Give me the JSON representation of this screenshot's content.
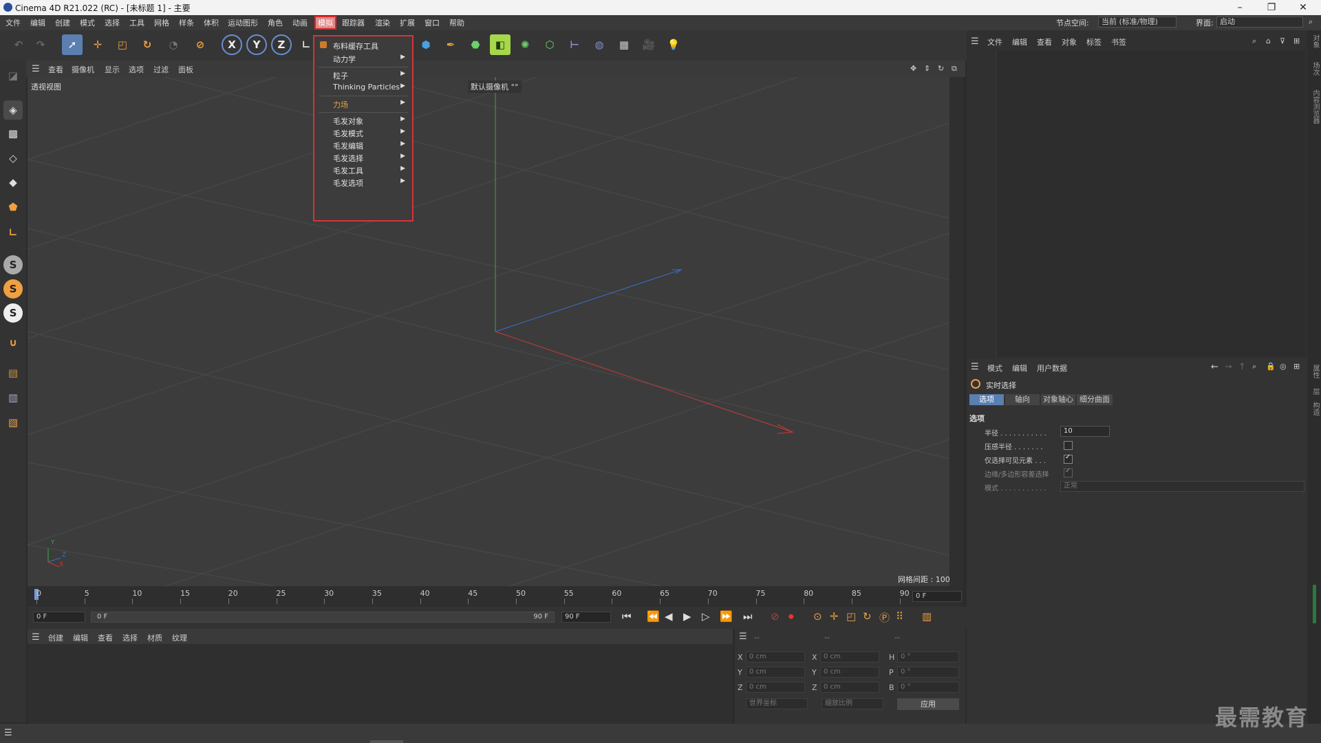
{
  "window": {
    "title": "Cinema 4D R21.022 (RC) - [未标题 1] - 主要",
    "min": "–",
    "restore": "❐",
    "close": "✕"
  },
  "menubar": {
    "items": [
      "文件",
      "编辑",
      "创建",
      "模式",
      "选择",
      "工具",
      "网格",
      "样条",
      "体积",
      "运动图形",
      "角色",
      "动画",
      "模拟",
      "跟踪器",
      "渲染",
      "扩展",
      "窗口",
      "帮助"
    ],
    "active": "模拟",
    "node_space_label": "节点空间:",
    "node_space_value": "当前 (标准/物理)",
    "layout_label": "界面:",
    "layout_value": "启动"
  },
  "dropdown": {
    "items": [
      {
        "label": "布料缓存工具",
        "submenu": false
      },
      {
        "label": "动力学",
        "submenu": true
      },
      {
        "label": "粒子",
        "submenu": true
      },
      {
        "label": "Thinking Particles",
        "submenu": true
      },
      {
        "label": "力场",
        "submenu": true
      },
      {
        "label": "毛发对象",
        "submenu": true
      },
      {
        "label": "毛发模式",
        "submenu": true
      },
      {
        "label": "毛发编辑",
        "submenu": true
      },
      {
        "label": "毛发选择",
        "submenu": true
      },
      {
        "label": "毛发工具",
        "submenu": true
      },
      {
        "label": "毛发选项",
        "submenu": true
      }
    ]
  },
  "toolbar": {
    "x": "X",
    "y": "Y",
    "z": "Z"
  },
  "viewport": {
    "menu": [
      "查看",
      "摄像机",
      "显示",
      "选项",
      "过滤",
      "面板"
    ],
    "name": "透视视图",
    "camera": "默认摄像机 °°",
    "grid_spacing": "网格间距 : 100 cm",
    "axis_y": "Y",
    "axis_z": "Z",
    "axis_x": "X"
  },
  "timeline": {
    "ticks": [
      "0",
      "5",
      "10",
      "15",
      "20",
      "25",
      "30",
      "35",
      "40",
      "45",
      "50",
      "55",
      "60",
      "65",
      "70",
      "75",
      "80",
      "85",
      "90"
    ],
    "current_frame": "0 F",
    "start_field": "0 F",
    "range_start": "0 F",
    "range_end": "90 F",
    "end_field": "90 F"
  },
  "materials": {
    "menu": [
      "创建",
      "编辑",
      "查看",
      "选择",
      "材质",
      "纹理"
    ]
  },
  "coords": {
    "header": [
      "--",
      "--",
      "--"
    ],
    "rows": [
      {
        "l1": "X",
        "v1": "0 cm",
        "l2": "X",
        "v2": "0 cm",
        "l3": "H",
        "v3": "0 °"
      },
      {
        "l1": "Y",
        "v1": "0 cm",
        "l2": "Y",
        "v2": "0 cm",
        "l3": "P",
        "v3": "0 °"
      },
      {
        "l1": "Z",
        "v1": "0 cm",
        "l2": "Z",
        "v2": "0 cm",
        "l3": "B",
        "v3": "0 °"
      }
    ],
    "space": "世界坐标",
    "scale": "缩放比例",
    "apply": "应用"
  },
  "object_manager": {
    "menu": [
      "文件",
      "编辑",
      "查看",
      "对象",
      "标签",
      "书签"
    ]
  },
  "attributes": {
    "menu": [
      "模式",
      "编辑",
      "用户数据"
    ],
    "tool_name": "实时选择",
    "tabs": [
      "选项",
      "轴向",
      "对象轴心",
      "细分曲面"
    ],
    "active_tab": "选项",
    "section": "选项",
    "radius_label": "半径 . . . . . . . . . . .",
    "radius_value": "10",
    "pressure_label": "压感半径 . . . . . . .",
    "visible_only_label": "仅选择可见元素 . . .",
    "edge_label": "边缘/多边形容差选择",
    "mode_label": "模式 . . . . . . . . . . .",
    "mode_value": "正常"
  },
  "right_strip": [
    "对象",
    "场次",
    "内容浏览器",
    "属性",
    "层",
    "构造"
  ],
  "watermark": "最需教育",
  "colors": {
    "accent": "#f0a040",
    "highlight_red": "#d9333a",
    "axis_x": "#c83a3a",
    "axis_y": "#3aa84a",
    "axis_z": "#3a6fc8"
  }
}
